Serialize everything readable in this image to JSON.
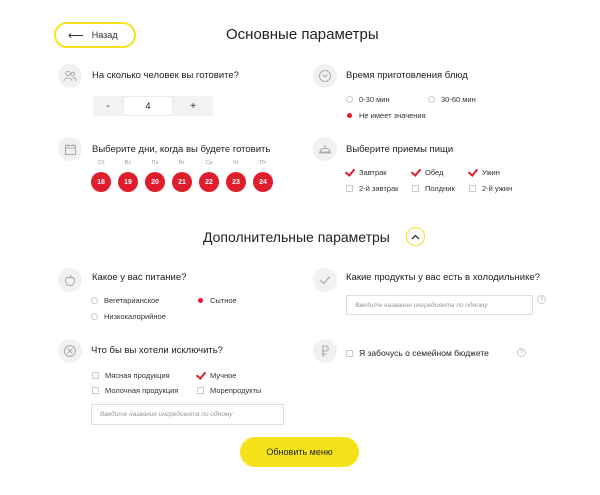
{
  "header": {
    "back_label": "Назад",
    "title": "Основные параметры"
  },
  "people": {
    "question": "На сколько человек вы готовите?",
    "minus": "-",
    "value": "4",
    "plus": "+"
  },
  "cook_time": {
    "question": "Время приготовления блюд",
    "options": [
      {
        "label": "0-30 мин",
        "selected": false
      },
      {
        "label": "30-60 мин",
        "selected": false
      },
      {
        "label": "Не имеет значения",
        "selected": true
      }
    ]
  },
  "days": {
    "question": "Выберите дни, когда вы будете готовить",
    "items": [
      {
        "weekday": "Сб",
        "date": "18"
      },
      {
        "weekday": "Вс",
        "date": "19"
      },
      {
        "weekday": "Пн",
        "date": "20"
      },
      {
        "weekday": "Вт",
        "date": "21"
      },
      {
        "weekday": "Ср",
        "date": "22"
      },
      {
        "weekday": "Чт",
        "date": "23"
      },
      {
        "weekday": "Пт",
        "date": "24"
      }
    ]
  },
  "meals": {
    "question": "Выберите приемы пищи",
    "options": [
      {
        "label": "Завтрак",
        "checked": true
      },
      {
        "label": "Обед",
        "checked": true
      },
      {
        "label": "Ужин",
        "checked": true
      },
      {
        "label": "2-й завтрак",
        "checked": false
      },
      {
        "label": "Полдник",
        "checked": false
      },
      {
        "label": "2-й ужин",
        "checked": false
      }
    ]
  },
  "additional": {
    "title": "Дополнительные параметры"
  },
  "diet": {
    "question": "Какое у вас питание?",
    "options": [
      {
        "label": "Вегетарианское",
        "selected": false
      },
      {
        "label": "Сытное",
        "selected": true
      },
      {
        "label": "Низкокалорийное",
        "selected": false
      }
    ]
  },
  "fridge": {
    "question": "Какие продукты у вас есть в холодильнике?",
    "placeholder": "Введите название ингредиента по одному",
    "help": "?"
  },
  "exclude": {
    "question": "Что бы вы хотели исключить?",
    "options": [
      {
        "label": "Мясная продукция",
        "checked": false
      },
      {
        "label": "Мучное",
        "checked": true
      },
      {
        "label": "Молочная продукция",
        "checked": false
      },
      {
        "label": "Морепродукты",
        "checked": false
      }
    ],
    "placeholder": "Введите название ингредиента по одному"
  },
  "budget": {
    "label": "Я забочусь о семейном бюджете",
    "checked": false,
    "help": "?"
  },
  "submit": {
    "label": "Обновить меню"
  },
  "colors": {
    "accent": "#f5e21a",
    "brand_red": "#e01d2d"
  }
}
